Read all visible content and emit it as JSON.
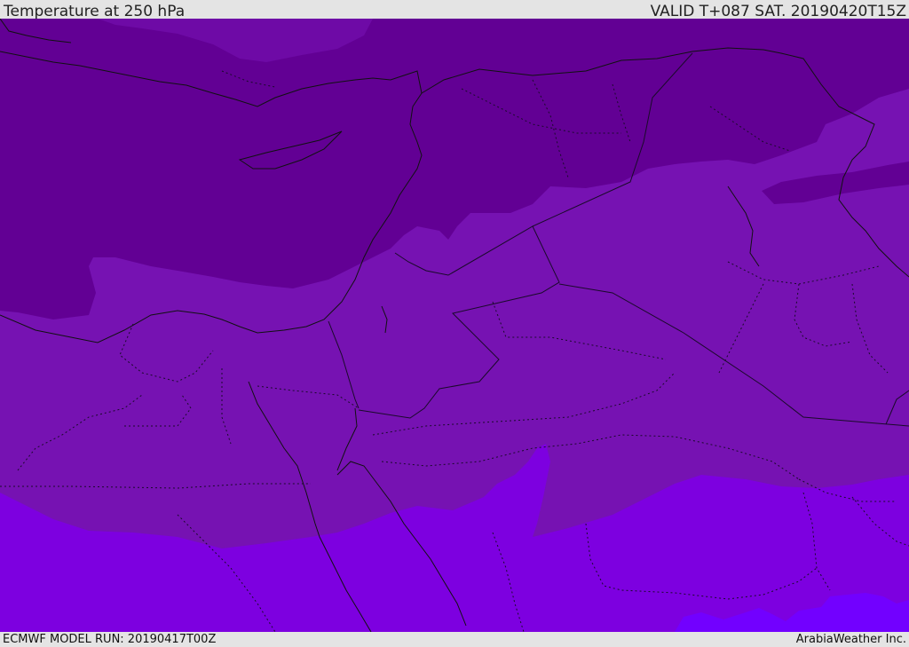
{
  "header": {
    "title": "Temperature at 250 hPa",
    "valid": "VALID T+087 SAT. 20190420T15Z"
  },
  "footer": {
    "model_run": "ECMWF MODEL RUN: 20190417T00Z",
    "credit": "ArabiaWeather Inc."
  },
  "colors": {
    "band_coldest": "#620094",
    "band_cold": "#6a049c",
    "band_mid": "#7612b2",
    "band_warm": "#7d00e0",
    "band_warmest": "#7200ff",
    "coastline": "#111111",
    "border": "#1a0a2a",
    "bar_bg": "#e4e4e4"
  }
}
